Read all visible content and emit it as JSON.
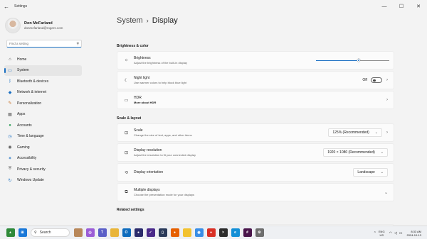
{
  "window": {
    "title": "Settings",
    "back_glyph": "←",
    "controls": [
      "—",
      "☐",
      "✕"
    ]
  },
  "profile": {
    "name": "Don McFarland",
    "email": "donmcfarland@rogers.com"
  },
  "search": {
    "placeholder": "Find a setting",
    "value": ""
  },
  "nav": {
    "items": [
      {
        "label": "Home",
        "icon": "home-icon",
        "glyph": "⌂",
        "color": "#444444"
      },
      {
        "label": "System",
        "icon": "system-icon",
        "glyph": "▭",
        "color": "#1a6fc2"
      },
      {
        "label": "Bluetooth & devices",
        "icon": "bluetooth-icon",
        "glyph": "ᛒ",
        "color": "#1a6fc2"
      },
      {
        "label": "Network & internet",
        "icon": "network-icon",
        "glyph": "◆",
        "color": "#1a6fc2"
      },
      {
        "label": "Personalization",
        "icon": "brush-icon",
        "glyph": "✎",
        "color": "#c4691c"
      },
      {
        "label": "Apps",
        "icon": "apps-icon",
        "glyph": "▦",
        "color": "#5a5a5a"
      },
      {
        "label": "Accounts",
        "icon": "accounts-icon",
        "glyph": "●",
        "color": "#2e9e58"
      },
      {
        "label": "Time & language",
        "icon": "time-language-icon",
        "glyph": "◷",
        "color": "#1a6fc2"
      },
      {
        "label": "Gaming",
        "icon": "gaming-icon",
        "glyph": "◉",
        "color": "#5a5a5a"
      },
      {
        "label": "Accessibility",
        "icon": "accessibility-icon",
        "glyph": "✶",
        "color": "#1a6fc2"
      },
      {
        "label": "Privacy & security",
        "icon": "shield-icon",
        "glyph": "⛨",
        "color": "#6a6a6a"
      },
      {
        "label": "Windows Update",
        "icon": "windows-update-icon",
        "glyph": "↻",
        "color": "#1a6fc2"
      }
    ],
    "selected_index": 1
  },
  "main": {
    "breadcrumb_parent": "System",
    "breadcrumb_sep": "›",
    "breadcrumb_current": "Display",
    "brightness_color": {
      "heading": "Brightness & color",
      "brightness": {
        "title": "Brightness",
        "subtitle": "Adjust the brightness of the built-in display",
        "glyph": "☼",
        "value_fraction": 0.58
      },
      "night_light": {
        "title": "Night light",
        "subtitle": "Use warmer colors to help block blue light",
        "glyph": "☾",
        "state": "Off",
        "chevron": "›"
      },
      "hdr": {
        "title": "HDR",
        "subtitle": "More about HDR",
        "glyph": "▭",
        "chevron": "›"
      }
    },
    "scale_layout": {
      "heading": "Scale & layout",
      "scale": {
        "title": "Scale",
        "subtitle": "Change the size of text, apps, and other items",
        "glyph": "⊡",
        "value": "125% (Recommended)",
        "chevron": "›"
      },
      "resolution": {
        "title": "Display resolution",
        "subtitle": "Adjust the resolution to fit your connected display",
        "glyph": "⊡",
        "value": "1920 × 1080 (Recommended)",
        "chevron": "⌄"
      },
      "orientation": {
        "title": "Display orientation",
        "glyph": "⟲",
        "value": "Landscape",
        "chevron": "⌄"
      },
      "multiple": {
        "title": "Multiple displays",
        "subtitle": "Choose the presentation mode for your displays",
        "glyph": "⧉",
        "chevron": "⌄"
      }
    },
    "related_heading": "Related settings"
  },
  "taskbar": {
    "search_label": "Search",
    "apps": [
      {
        "name": "widgets-icon",
        "color": "#2f8a3a",
        "glyph": "▲"
      },
      {
        "name": "windows-start-icon",
        "color": "#1a78d8",
        "glyph": "⊞"
      },
      {
        "name": "photo-app-icon",
        "color": "#b8875a",
        "glyph": ""
      },
      {
        "name": "copilot-icon",
        "color": "#9b5cd6",
        "glyph": "◎"
      },
      {
        "name": "teams-icon",
        "color": "#5b5fc7",
        "glyph": "T"
      },
      {
        "name": "file-explorer-icon",
        "color": "#e9b53a",
        "glyph": ""
      },
      {
        "name": "outlook-icon",
        "color": "#0f6cbd",
        "glyph": "O"
      },
      {
        "name": "media-app-icon",
        "color": "#2b2b6b",
        "glyph": "●"
      },
      {
        "name": "todo-app-icon",
        "color": "#4a2a8a",
        "glyph": "✓"
      },
      {
        "name": "phone-link-icon",
        "color": "#2a3a5a",
        "glyph": "▯"
      },
      {
        "name": "firefox-icon",
        "color": "#e66000",
        "glyph": "●"
      },
      {
        "name": "notes-app-icon",
        "color": "#f2c230",
        "glyph": ""
      },
      {
        "name": "chrome-icon",
        "color": "#3a8ee6",
        "glyph": "◉"
      },
      {
        "name": "browser-app-icon",
        "color": "#d93025",
        "glyph": "●"
      },
      {
        "name": "terminal-icon",
        "color": "#2b2b2b",
        "glyph": ">"
      },
      {
        "name": "edge-icon",
        "color": "#138fd6",
        "glyph": "e"
      },
      {
        "name": "slack-icon",
        "color": "#4a154b",
        "glyph": "#"
      },
      {
        "name": "settings-gear-icon",
        "color": "#6e6e6e",
        "glyph": "⚙"
      }
    ],
    "lang_top": "ENG",
    "lang_bottom": "US",
    "time": "8:33 AM",
    "date": "2024-10-13"
  }
}
